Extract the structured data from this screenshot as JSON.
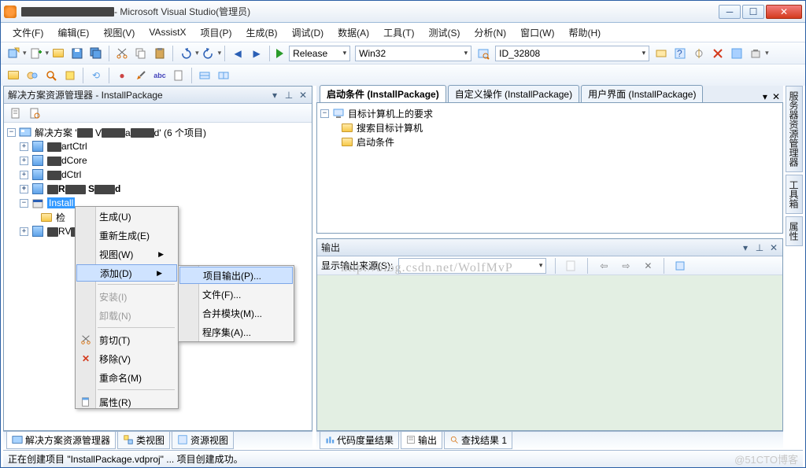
{
  "title": " - Microsoft Visual Studio(管理员)",
  "menu": [
    "文件(F)",
    "编辑(E)",
    "视图(V)",
    "VAssistX",
    "项目(P)",
    "生成(B)",
    "调试(D)",
    "数据(A)",
    "工具(T)",
    "测试(S)",
    "分析(N)",
    "窗口(W)",
    "帮助(H)"
  ],
  "config_combo": "Release",
  "platform_combo": "Win32",
  "id_combo": "ID_32808",
  "solution_explorer": {
    "title": "解决方案资源管理器 - InstallPackage",
    "root_prefix": "解决方案 '",
    "root_suffix": "d' (6 个项目)",
    "items": [
      {
        "label": "artCtrl"
      },
      {
        "label": "dCore"
      },
      {
        "label": "dCtrl"
      },
      {
        "label": "R"
      },
      {
        "label_suffix": "d",
        "bold": true
      }
    ],
    "selected": "Install",
    "children": [
      {
        "label": "检"
      },
      {
        "label": "RV"
      }
    ],
    "tabs": [
      "解决方案资源管理器",
      "类视图",
      "资源视图"
    ]
  },
  "right_tabs": [
    "启动条件 (InstallPackage)",
    "自定义操作 (InstallPackage)",
    "用户界面 (InstallPackage)"
  ],
  "launch_tree": {
    "root": "目标计算机上的要求",
    "items": [
      "搜索目标计算机",
      "启动条件"
    ]
  },
  "output": {
    "title": "输出",
    "source_label": "显示输出来源(S):",
    "watermark": "http://blog.csdn.net/WolfMvP"
  },
  "bottom_tabs": [
    "代码度量结果",
    "输出",
    "查找结果 1"
  ],
  "side_tabs": [
    "服务器资源管理器",
    "工具箱",
    "属性"
  ],
  "statusbar": "正在创建项目  \"InstallPackage.vdproj\"  ... 项目创建成功。",
  "status_watermark": "@51CTO博客",
  "context_menu": {
    "items": [
      {
        "label": "生成(U)"
      },
      {
        "label": "重新生成(E)"
      },
      {
        "label": "视图(W)",
        "sub": true
      },
      {
        "label": "添加(D)",
        "sub": true,
        "hover": true
      },
      {
        "sep": true
      },
      {
        "label": "安装(I)",
        "disabled": true
      },
      {
        "label": "卸载(N)",
        "disabled": true
      },
      {
        "sep": true
      },
      {
        "label": "剪切(T)",
        "icon": "cut"
      },
      {
        "label": "移除(V)",
        "icon": "remove"
      },
      {
        "label": "重命名(M)"
      },
      {
        "sep": true
      },
      {
        "label": "属性(R)",
        "icon": "prop"
      }
    ],
    "submenu": [
      {
        "label": "项目输出(P)...",
        "hover": true
      },
      {
        "label": "文件(F)..."
      },
      {
        "label": "合并模块(M)..."
      },
      {
        "label": "程序集(A)..."
      }
    ]
  }
}
